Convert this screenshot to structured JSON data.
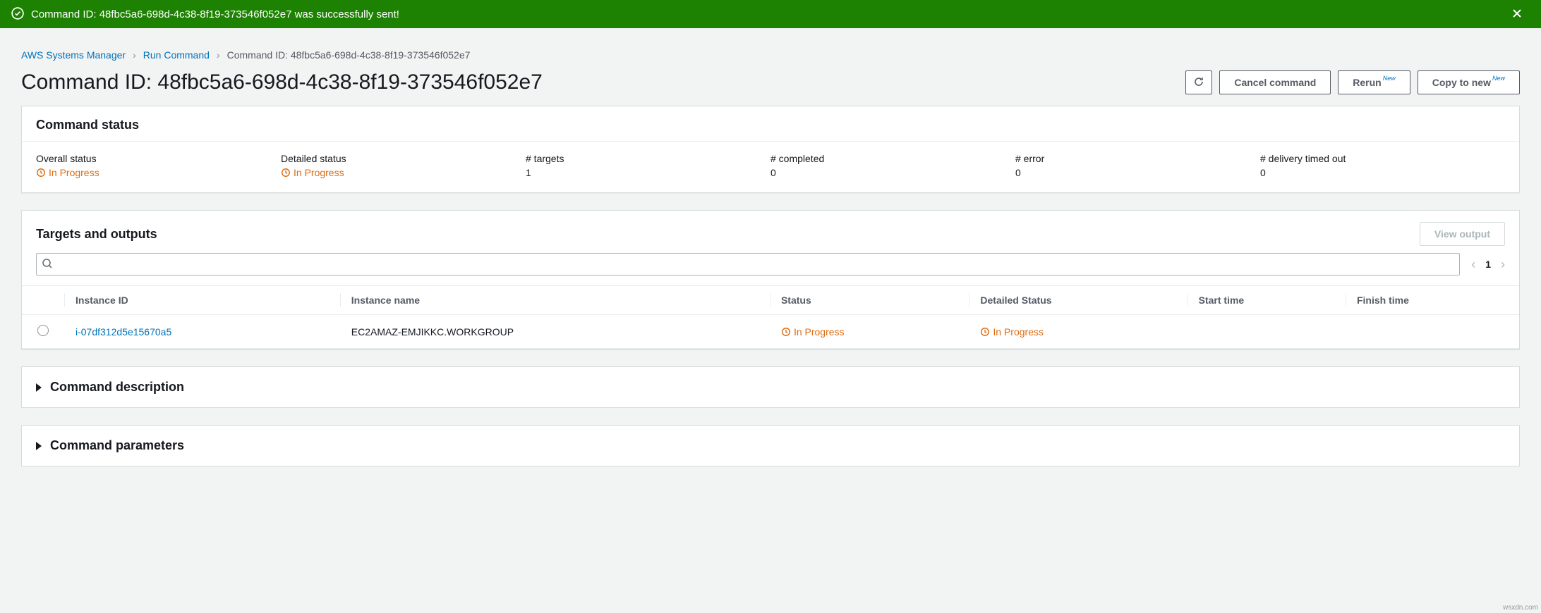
{
  "flash": {
    "message": "Command ID: 48fbc5a6-698d-4c38-8f19-373546f052e7 was successfully sent!"
  },
  "breadcrumbs": {
    "items": [
      "AWS Systems Manager",
      "Run Command",
      "Command ID: 48fbc5a6-698d-4c38-8f19-373546f052e7"
    ]
  },
  "header": {
    "title": "Command ID: 48fbc5a6-698d-4c38-8f19-373546f052e7",
    "actions": {
      "cancel": "Cancel command",
      "rerun": "Rerun",
      "copy": "Copy to new",
      "badge": "New"
    }
  },
  "command_status": {
    "title": "Command status",
    "items": {
      "overall_label": "Overall status",
      "overall_value": "In Progress",
      "detailed_label": "Detailed status",
      "detailed_value": "In Progress",
      "targets_label": "# targets",
      "targets_value": "1",
      "completed_label": "# completed",
      "completed_value": "0",
      "error_label": "# error",
      "error_value": "0",
      "timedout_label": "# delivery timed out",
      "timedout_value": "0"
    }
  },
  "targets": {
    "title": "Targets and outputs",
    "view_output": "View output",
    "page": "1",
    "columns": {
      "instance_id": "Instance ID",
      "instance_name": "Instance name",
      "status": "Status",
      "detailed_status": "Detailed Status",
      "start_time": "Start time",
      "finish_time": "Finish time"
    },
    "rows": [
      {
        "instance_id": "i-07df312d5e15670a5",
        "instance_name": "EC2AMAZ-EMJIKKC.WORKGROUP",
        "status": "In Progress",
        "detailed_status": "In Progress",
        "start_time": "",
        "finish_time": ""
      }
    ]
  },
  "collapse": {
    "description": "Command description",
    "parameters": "Command parameters"
  },
  "watermark": "wsxdn.com"
}
